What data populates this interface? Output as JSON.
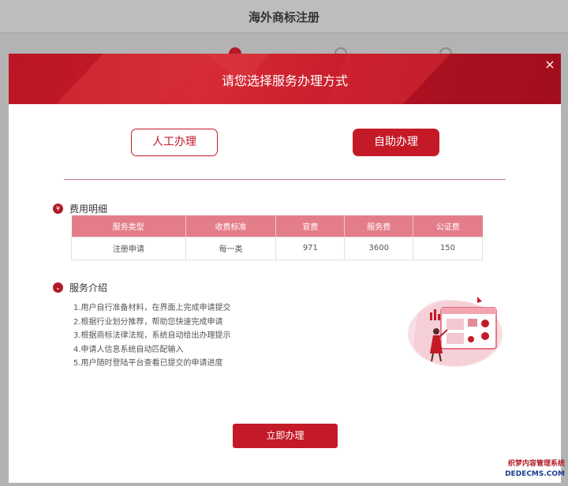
{
  "background_page": {
    "title": "海外商标注册"
  },
  "modal": {
    "title": "请您选择服务办理方式",
    "close_symbol": "×",
    "modes": {
      "manual_label": "人工办理",
      "self_label": "自助办理",
      "selected": "自助办理"
    },
    "fee_section": {
      "heading": "费用明细",
      "icon": "yen-icon",
      "icon_glyph": "¥",
      "columns": [
        "服务类型",
        "收费标准",
        "官费",
        "服务费",
        "公证费"
      ],
      "rows": [
        [
          "注册申请",
          "每一类",
          "971",
          "3600",
          "150"
        ]
      ]
    },
    "intro_section": {
      "heading": "服务介绍",
      "icon": "chevron-down-icon",
      "icon_glyph": "⌄",
      "items": [
        "1.用户自行准备材料，在界面上完成申请提交",
        "2.根据行业划分推荐，帮助您快速完成申请",
        "3.根据商标法律法规，系统自动给出办理提示",
        "4.申请人信息系统自动匹配输入",
        "5.用户随时登陆平台查看已提交的申请进度"
      ]
    },
    "apply_button_label": "立即办理"
  },
  "watermark": {
    "line1": "织梦内容管理系统",
    "line2": "DEDECMS.COM"
  },
  "colors": {
    "brand_red": "#c41a28",
    "table_header": "#e47d8a",
    "divider": "#c67c86"
  }
}
